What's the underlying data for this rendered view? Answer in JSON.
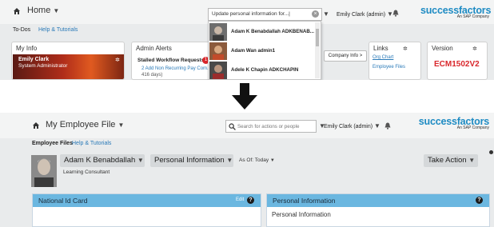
{
  "top": {
    "title": "Home",
    "subnav": {
      "todos": "To-Dos",
      "help": "Help & Tutorials"
    },
    "search": {
      "value": "Update personal information for...",
      "cursor": "|"
    },
    "user": "Emily Clark (admin)",
    "logo": {
      "word": "successfactors",
      "sub": "An SAP Company"
    },
    "dropdown_items": [
      {
        "label": "Adam K Benabdallah ADKBENAB..."
      },
      {
        "label": "Adam Wan admin1"
      },
      {
        "label": "Adele K Chapin ADKCHAPIN"
      }
    ],
    "myinfo": {
      "title": "My Info",
      "name": "Emily Clark",
      "role": "System Administrator"
    },
    "alerts": {
      "title": "Admin Alerts",
      "sub": "Stalled Workflow Requests",
      "badge": "1",
      "line1": "2  Add Non Recurring Pay Com...",
      "line2": "416 days)"
    },
    "company_info_button": "Company Info >",
    "links": {
      "title": "Links",
      "items": [
        "Org Chart",
        "Employee Files"
      ]
    },
    "version": {
      "title": "Version",
      "value": "ECM1502V2"
    }
  },
  "bottom": {
    "title": "My Employee File",
    "search_placeholder": "Search for actions or people",
    "user": "Emily Clark (admin)",
    "logo": {
      "word": "successfactors",
      "sub": "An SAP Company"
    },
    "subnav": {
      "employee_files": "Employee Files",
      "help": "Help & Tutorials"
    },
    "employee_name": "Adam K Benabdallah",
    "role": "Learning Consultant",
    "section": "Personal Information",
    "as_of": "As Of: Today",
    "take_action": "Take Action",
    "panels": [
      {
        "title": "National Id Card",
        "edit": "Edit",
        "help": "?"
      },
      {
        "title": "Personal Information",
        "help": "?",
        "body": "Personal Information"
      }
    ]
  },
  "colors": {
    "accent_blue": "#1e8bc3",
    "panel_header": "#6bb7e0",
    "alert_red": "#d9262b",
    "link_blue": "#2a7ab8"
  },
  "icons": [
    "home-icon",
    "bell-icon",
    "search-icon",
    "gear-icon",
    "clear-icon",
    "chevron-down-icon",
    "help-icon",
    "down-arrow-icon"
  ]
}
